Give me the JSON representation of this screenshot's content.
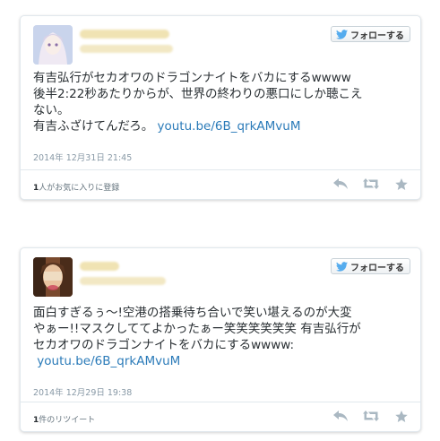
{
  "follow_label": "フォローする",
  "tweets": [
    {
      "text_line1": "有吉弘行がセカオワのドラゴンナイトをバカにするwwww",
      "text_line2": "後半2:22秒あたりからが、世界の終わりの悪口にしか聴こえ",
      "text_line3": "ない。",
      "text_line4": "有吉ふざけてんだろ。",
      "link": "youtu.be/6B_qrkAMvuM",
      "date": "2014年 12月31日  21:45",
      "footer_count": "1",
      "footer_label": "人がお気に入りに登録"
    },
    {
      "text_line1": "面白すぎるぅ〜!空港の搭乗待ち合いで笑い堪えるのが大変",
      "text_line2": "やぁー!!マスクしててよかったぁー笑笑笑笑笑笑 有吉弘行が",
      "text_line3": "セカオワのドラゴンナイトをバカにするwwww:",
      "link": "youtu.be/6B_qrkAMvuM",
      "date": "2014年 12月29日  19:38",
      "footer_count": "1",
      "footer_label": "件のリツイート"
    }
  ],
  "colors": {
    "link": "#2b7bb9",
    "icon": "#aab8c2",
    "text": "#292f33",
    "meta": "#8899a6"
  }
}
